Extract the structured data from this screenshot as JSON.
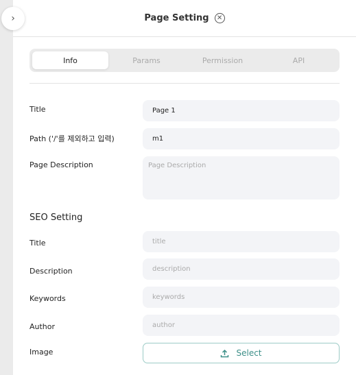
{
  "header": {
    "title": "Page Setting",
    "toggle_icon": "chevron-right-icon",
    "close_icon": "close-circle-icon"
  },
  "tabs": [
    {
      "label": "Info",
      "active": true
    },
    {
      "label": "Params"
    },
    {
      "label": "Permission"
    },
    {
      "label": "API"
    }
  ],
  "info": {
    "title": {
      "label": "Title",
      "value": "Page 1"
    },
    "path": {
      "label": "Path ('/'를 제외하고 입력)",
      "value": "m1"
    },
    "description": {
      "label": "Page Description",
      "value": "",
      "placeholder": "Page Description"
    }
  },
  "seo": {
    "heading": "SEO Setting",
    "title": {
      "label": "Title",
      "value": "",
      "placeholder": "title"
    },
    "description": {
      "label": "Description",
      "value": "",
      "placeholder": "description"
    },
    "keywords": {
      "label": "Keywords",
      "value": "",
      "placeholder": "keywords"
    },
    "author": {
      "label": "Author",
      "value": "",
      "placeholder": "author"
    },
    "image": {
      "label": "Image",
      "button": "Select",
      "icon": "upload-icon"
    }
  },
  "colors": {
    "accent": "#3d8f88",
    "field_bg": "#f3f4f7"
  }
}
